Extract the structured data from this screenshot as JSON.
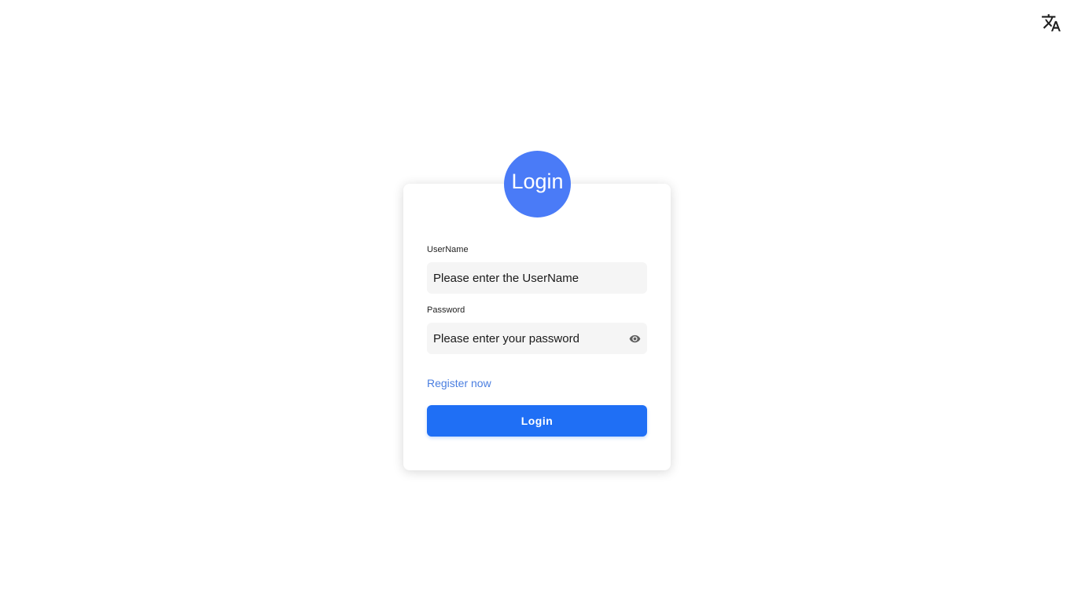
{
  "header": {
    "translate_icon": "translate-icon"
  },
  "login_card": {
    "avatar_text": "Login",
    "username": {
      "label": "UserName",
      "value": "",
      "placeholder": "Please enter the UserName"
    },
    "password": {
      "label": "Password",
      "value": "",
      "placeholder": "Please enter your password",
      "toggle_icon": "eye-icon"
    },
    "register_link": "Register now",
    "login_button": "Login"
  },
  "colors": {
    "avatar": "#4a7bf7",
    "primary_button": "#1f6ff5",
    "link": "#4a7ee0",
    "input_background": "#f5f5f5"
  }
}
